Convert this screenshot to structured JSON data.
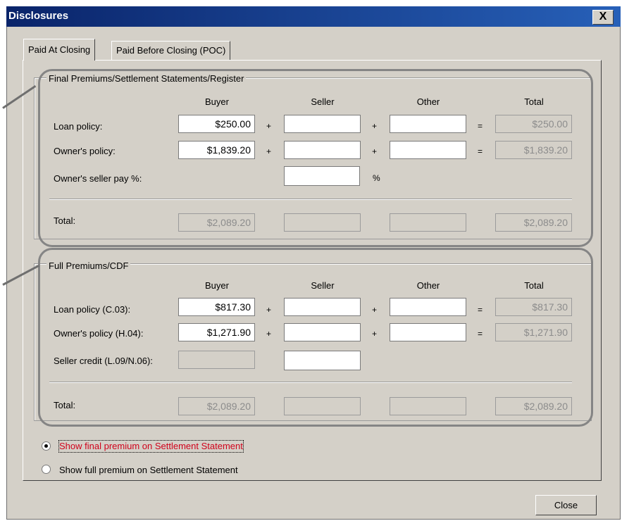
{
  "window": {
    "title": "Disclosures",
    "close_symbol": "X"
  },
  "tabs": [
    {
      "label": "Paid At Closing",
      "active": true
    },
    {
      "label": "Paid Before Closing (POC)",
      "active": false
    }
  ],
  "columns": {
    "buyer": "Buyer",
    "seller": "Seller",
    "other": "Other",
    "total": "Total"
  },
  "ops": {
    "plus": "+",
    "equals": "=",
    "percent": "%"
  },
  "final_group": {
    "title": "Final Premiums/Settlement Statements/Register",
    "rows": [
      {
        "label": "Loan policy:",
        "buyer": "$250.00",
        "seller": "",
        "other": "",
        "total": "$250.00"
      },
      {
        "label": "Owner's policy:",
        "buyer": "$1,839.20",
        "seller": "",
        "other": "",
        "total": "$1,839.20"
      }
    ],
    "seller_pay": {
      "label": "Owner's seller pay %:",
      "value": ""
    },
    "totals": {
      "label": "Total:",
      "buyer": "$2,089.20",
      "seller": "",
      "other": "",
      "total": "$2,089.20"
    }
  },
  "full_group": {
    "title": "Full Premiums/CDF",
    "rows": [
      {
        "label": "Loan policy (C.03):",
        "buyer": "$817.30",
        "seller": "",
        "other": "",
        "total": "$817.30"
      },
      {
        "label": "Owner's policy (H.04):",
        "buyer": "$1,271.90",
        "seller": "",
        "other": "",
        "total": "$1,271.90"
      }
    ],
    "seller_credit": {
      "label": "Seller credit (L.09/N.06):",
      "buyer": "",
      "seller": ""
    },
    "totals": {
      "label": "Total:",
      "buyer": "$2,089.20",
      "seller": "",
      "other": "",
      "total": "$2,089.20"
    }
  },
  "radios": [
    {
      "label": "Show final premium on Settlement Statement",
      "checked": true,
      "color": "#d0021b"
    },
    {
      "label": "Show full premium on Settlement Statement",
      "checked": false,
      "color": "#000000"
    }
  ],
  "footer": {
    "close_label": "Close"
  }
}
